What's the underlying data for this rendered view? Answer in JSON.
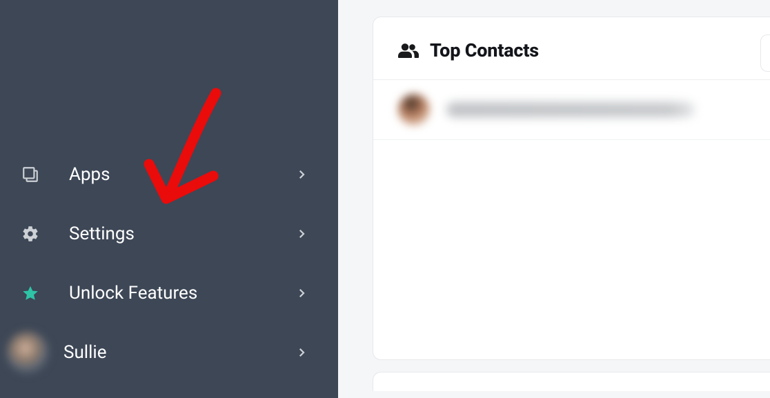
{
  "sidebar": {
    "items": [
      {
        "label": "Apps",
        "icon": "apps-icon"
      },
      {
        "label": "Settings",
        "icon": "gear-icon"
      },
      {
        "label": "Unlock Features",
        "icon": "star-icon"
      },
      {
        "label": "Sullie",
        "icon": "avatar"
      }
    ]
  },
  "main": {
    "card_title": "Top Contacts"
  },
  "annotation": {
    "kind": "red-arrow",
    "points_to": "Settings"
  },
  "colors": {
    "sidebar_bg": "#3d4756",
    "star_accent": "#2ec4a6",
    "arrow": "#ea0b0b"
  }
}
